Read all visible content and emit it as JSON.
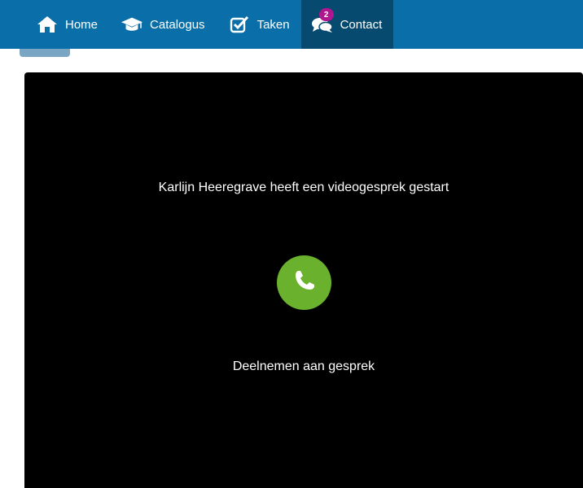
{
  "nav": {
    "items": [
      {
        "label": "Home",
        "icon": "home-icon",
        "active": false
      },
      {
        "label": "Catalogus",
        "icon": "graduation-cap-icon",
        "active": false
      },
      {
        "label": "Taken",
        "icon": "checkbox-icon",
        "active": false
      },
      {
        "label": "Contact",
        "icon": "chat-bubbles-icon",
        "active": true,
        "badge": "2"
      }
    ]
  },
  "call": {
    "title": "Karlijn Heeregrave heeft een videogesprek gestart",
    "join_label": "Deelnemen aan gesprek",
    "button_icon": "phone-icon"
  },
  "colors": {
    "topbar": "#0a6fa8",
    "active_nav": "#074a6f",
    "badge": "#b0168f",
    "call_button": "#6ab22d",
    "video_bg": "#000000"
  }
}
